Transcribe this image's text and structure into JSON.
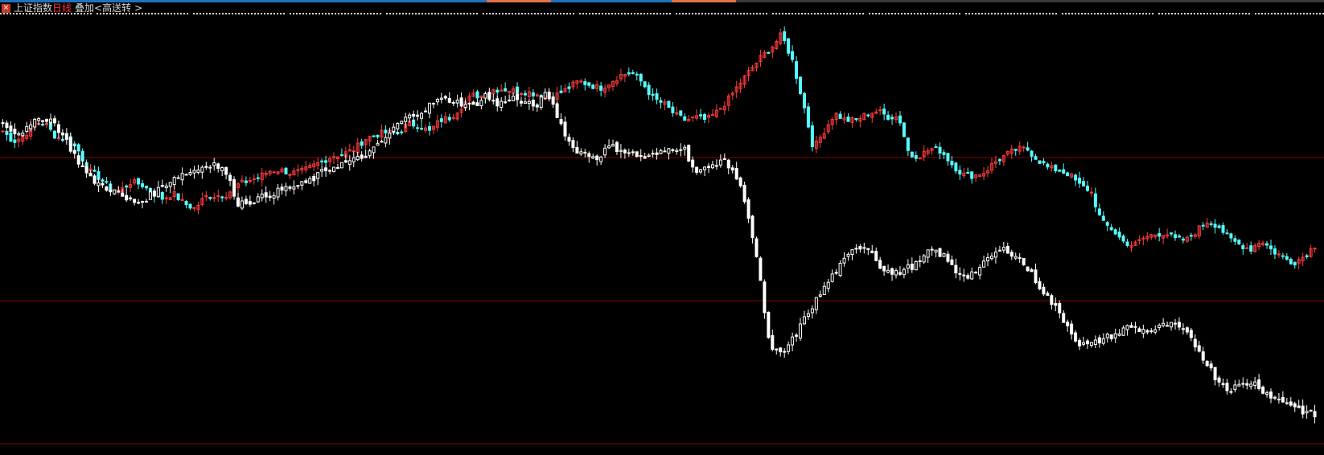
{
  "header": {
    "index_name": "上证指数",
    "period": "日线",
    "overlay_prefix": "叠加<",
    "overlay_name": "高送转",
    "overlay_suffix": ">",
    "close_glyph": "×"
  },
  "colors": {
    "background": "#000000",
    "up": "#ff3b3b",
    "down": "#54ffff",
    "overlay": "#ffffff",
    "gridline": "#8b0000",
    "topbar": [
      "#1e73be",
      "#e2704a",
      "#1e73be",
      "#e2704a",
      "#3a3a3a"
    ]
  },
  "chart_data": {
    "type": "candlestick",
    "title": "",
    "grid": true,
    "series": [
      {
        "name": "上证指数",
        "style": "candles-red-cyan",
        "close": [
          100.0,
          98.5,
          99.3,
          101.2,
          101.0,
          99.1,
          98.8,
          97.5,
          94.5,
          93.5,
          92.0,
          91.6,
          92.8,
          92.5,
          91.3,
          90.5,
          91.2,
          89.8,
          89.1,
          90.8,
          90.9,
          91.1,
          92.4,
          93.0,
          93.5,
          94.4,
          94.5,
          94.1,
          94.3,
          95.0,
          95.8,
          96.5,
          96.8,
          97.5,
          98.9,
          99.5,
          99.8,
          99.6,
          101.0,
          100.8,
          99.9,
          101.5,
          101.9,
          103.5,
          105.0,
          104.9,
          105.8,
          105.9,
          105.6,
          105.5,
          105.2,
          104.8,
          105.1,
          106.0,
          107.0,
          106.5,
          106.0,
          106.9,
          107.9,
          108.2,
          106.7,
          104.5,
          103.8,
          102.3,
          101.5,
          101.9,
          101.5,
          102.7,
          104.4,
          106.5,
          108.4,
          110.2,
          111.6,
          113.5,
          110.0,
          104.2,
          97.5,
          100.0,
          102.5,
          101.5,
          101.5,
          102.4,
          102.8,
          102.0,
          102.0,
          96.5,
          96.6,
          97.5,
          97.2,
          95.3,
          93.9,
          93.7,
          94.2,
          95.6,
          96.6,
          97.4,
          97.5,
          96.0,
          94.8,
          94.5,
          93.9,
          92.3,
          91.6,
          87.2,
          86.2,
          84.5,
          83.9,
          85.0,
          85.5,
          85.7,
          84.7,
          84.7,
          86.1,
          87.4,
          86.6,
          84.8,
          84.0,
          83.4,
          84.7,
          83.2,
          82.3,
          81.5,
          82.4,
          83.9
        ]
      },
      {
        "name": "高送转",
        "style": "candles-white-hollow",
        "close": [
          100.0,
          98.5,
          99.0,
          100.5,
          100.2,
          97.8,
          95.0,
          92.5,
          91.5,
          90.8,
          89.6,
          89.2,
          90.3,
          91.5,
          92.8,
          93.2,
          93.9,
          94.5,
          93.3,
          89.2,
          89.4,
          90.0,
          90.6,
          91.2,
          91.5,
          92.3,
          93.5,
          94.2,
          94.7,
          95.2,
          96.3,
          98.0,
          99.8,
          100.8,
          101.5,
          102.8,
          102.9,
          102.5,
          102.0,
          103.5,
          102.1,
          103.3,
          102.5,
          102.0,
          103.8,
          100.0,
          96.5,
          95.8,
          95.2,
          96.7,
          96.3,
          95.6,
          95.2,
          95.7,
          96.5,
          96.6,
          93.2,
          93.8,
          95.0,
          93.6,
          89.5,
          81.0,
          69.5,
          69.2,
          71.5,
          74.5,
          77.0,
          79.5,
          81.5,
          83.5,
          83.3,
          80.6,
          79.7,
          80.5,
          81.2,
          83.0,
          82.2,
          80.1,
          79.6,
          80.6,
          82.4,
          83.1,
          82.1,
          80.0,
          77.6,
          75.4,
          73.0,
          70.4,
          70.4,
          71.3,
          71.8,
          72.9,
          72.3,
          72.3,
          73.1,
          72.7,
          71.2,
          68.7,
          66.0,
          64.5,
          65.0,
          65.5,
          64.1,
          63.1,
          62.6,
          61.6,
          61.0
        ]
      }
    ],
    "horizontal_lines": 3
  }
}
